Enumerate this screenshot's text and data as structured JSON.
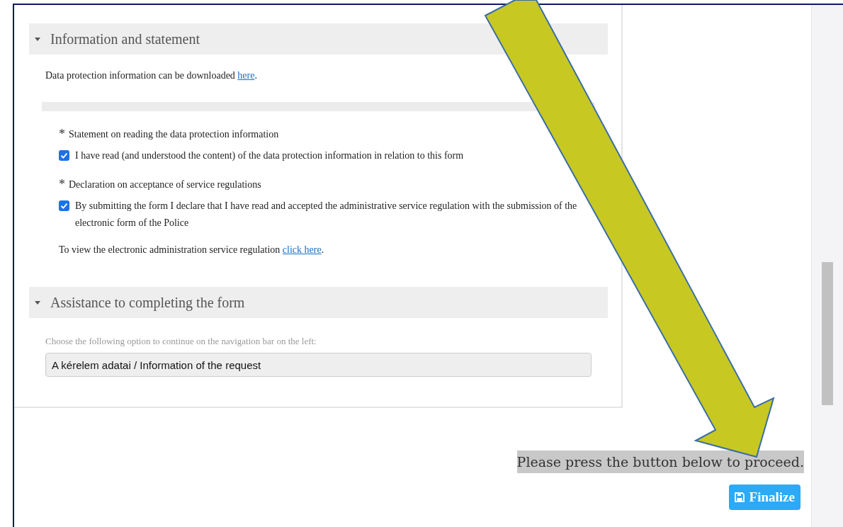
{
  "sections": [
    {
      "title": "Information and statement",
      "expanded": true,
      "kind": "statements",
      "intro": {
        "before": "Data protection information can be downloaded ",
        "link": "here",
        "after": "."
      },
      "items": [
        {
          "kind": "label",
          "mark": "*",
          "text": "Statement on reading the data protection information"
        },
        {
          "kind": "checkbox",
          "checked": true,
          "text": "I have read (and understood the content) of the data protection information in relation to this form"
        },
        {
          "kind": "label",
          "mark": "*",
          "text": "Declaration on acceptance of service regulations"
        },
        {
          "kind": "checkbox",
          "checked": true,
          "text": "By submitting the form I declare that I have read and accepted the administrative service regulation with the submission of the electronic form of the Police"
        },
        {
          "kind": "linktext",
          "before": "To view the electronic administration service regulation ",
          "link": "click here",
          "after": "."
        }
      ]
    },
    {
      "title": "Assistance to completing the form",
      "expanded": true,
      "kind": "navigation",
      "hint": "Choose the following option to continue on the navigation bar on the left:",
      "value": "A kérelem adatai / Information of the request"
    }
  ],
  "proceed_text": "Please press the button below to proceed.",
  "finalize_button": "Finalize"
}
